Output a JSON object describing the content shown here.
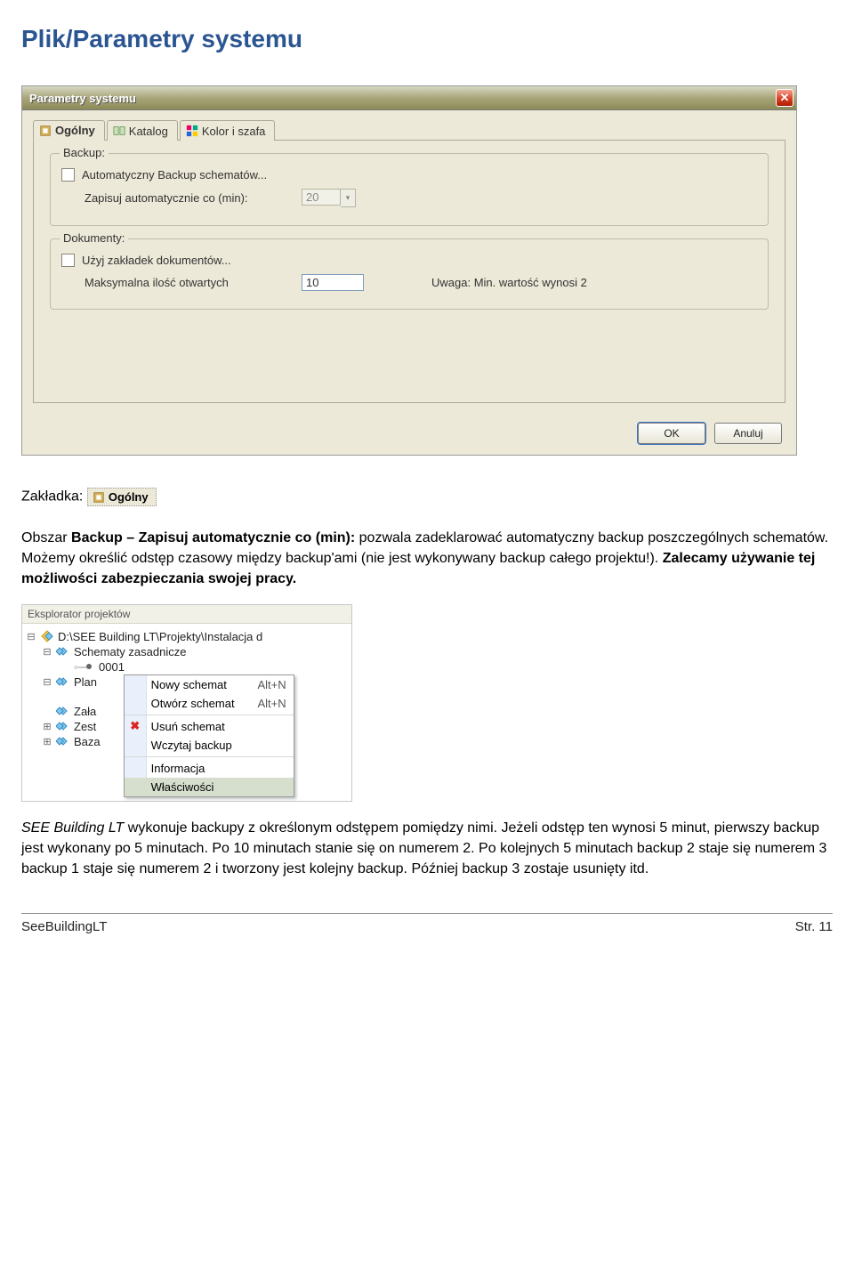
{
  "page_title": "Plik/Parametry systemu",
  "dialog": {
    "title": "Parametry systemu",
    "close_glyph": "✕",
    "tabs": [
      {
        "label": "Ogólny",
        "active": true
      },
      {
        "label": "Katalog",
        "active": false
      },
      {
        "label": "Kolor i szafa",
        "active": false
      }
    ],
    "group_backup": {
      "title": "Backup:",
      "auto_backup_label": "Automatyczny Backup schematów...",
      "interval_label": "Zapisuj automatycznie co (min):",
      "interval_value": "20"
    },
    "group_docs": {
      "title": "Dokumenty:",
      "use_tabs_label": "Użyj zakładek dokumentów...",
      "max_open_label": "Maksymalna ilość otwartych",
      "max_open_value": "10",
      "note": "Uwaga: Min. wartość wynosi 2"
    },
    "ok_label": "OK",
    "cancel_label": "Anuluj"
  },
  "zakladka_label": "Zakładka:",
  "mini_tab_label": "Ogólny",
  "para1_parts": {
    "a": "Obszar ",
    "b": "Backup – Zapisuj automatycznie  co (min): ",
    "c": "pozwala zadeklarować automatyczny backup poszczególnych schematów. Możemy określić odstęp czasowy między backup'ami (nie jest wykonywany backup całego projektu!). ",
    "d": "Zalecamy używanie tej możliwości zabezpieczania swojej pracy."
  },
  "explorer": {
    "title": "Eksplorator projektów",
    "root": "D:\\SEE Building LT\\Projekty\\Instalacja d",
    "items": {
      "schematy": "Schematy zasadnicze",
      "i0001": "0001",
      "plan": "Plan",
      "zala": "Zała",
      "zest": "Zest",
      "baza": "Baza"
    },
    "menu": {
      "nowy": "Nowy schemat",
      "otworz": "Otwórz schemat",
      "usun": "Usuń schemat",
      "wczytaj": "Wczytaj backup",
      "informacja": "Informacja",
      "wlasciwosci": "Właściwości",
      "shortcut": "Alt+N"
    }
  },
  "para2": "SEE Building LT wykonuje backupy z określonym odstępem pomiędzy nimi. Jeżeli odstęp ten wynosi 5 minut, pierwszy backup jest wykonany po 5 minutach. Po 10 minutach stanie się on numerem 2. Po kolejnych 5 minutach backup 2 staje się numerem 3 backup 1 staje się numerem 2 i tworzony jest kolejny backup. Później backup 3 zostaje usunięty itd.",
  "footer": {
    "left": "SeeBuildingLT",
    "right": "Str. 11"
  }
}
